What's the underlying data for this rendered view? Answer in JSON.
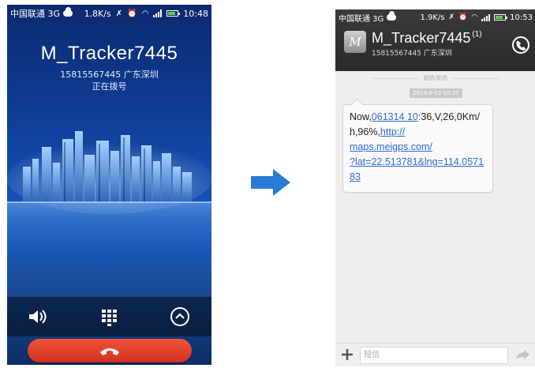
{
  "left_screen": {
    "status": {
      "carrier": "中国联通 3G",
      "speed": "1.8K/s",
      "time": "10:48"
    },
    "caller": {
      "name": "M_Tracker7445",
      "number_location": "15815567445 广东深圳",
      "status": "正在拨号"
    },
    "controls": [
      {
        "name": "speaker-icon"
      },
      {
        "name": "keypad-icon"
      },
      {
        "name": "expand-up-icon"
      }
    ],
    "end_call": {
      "icon": "hangup-phone-icon",
      "color": "#e2402a"
    }
  },
  "right_screen": {
    "status": {
      "carrier": "中国联通 3G",
      "speed": "1.9K/s",
      "time": "10:53"
    },
    "header": {
      "contact_name": "M_Tracker7445",
      "count": "(1)",
      "number_location": "15815567445 广东深圳"
    },
    "thread_label": "短信/彩信",
    "date": "2014-6-13 10:37",
    "message": {
      "line1_prefix": "Now,",
      "line1_link": "061314 10",
      "line1_suffix": ":36,V,26,0Km/",
      "line2_text": "h,96%,",
      "line2_link": "http://",
      "line3_link": "maps.meigps.com/",
      "line4_link": "?lat=22.513781&lng=114.0571",
      "line5_link": "83"
    },
    "compose": {
      "placeholder": "短信"
    },
    "link_color": "#2f6cd8"
  }
}
